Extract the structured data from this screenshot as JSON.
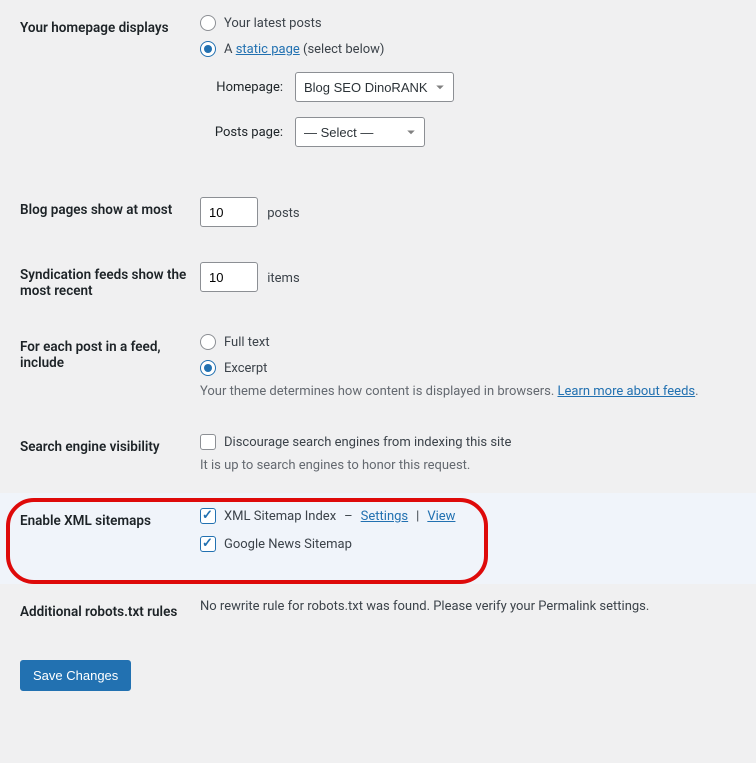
{
  "homepage": {
    "label": "Your homepage displays",
    "latest_posts": "Your latest posts",
    "static_page_prefix": "A ",
    "static_page_link": "static page",
    "static_page_suffix": " (select below)",
    "homepage_label": "Homepage:",
    "homepage_select": "Blog SEO DinoRANK",
    "posts_page_label": "Posts page:",
    "posts_page_select": "— Select —"
  },
  "blog_pages": {
    "label": "Blog pages show at most",
    "value": "10",
    "unit": "posts"
  },
  "syndication": {
    "label": "Syndication feeds show the most recent",
    "value": "10",
    "unit": "items"
  },
  "feed_content": {
    "label": "For each post in a feed, include",
    "full": "Full text",
    "excerpt": "Excerpt",
    "desc_prefix": "Your theme determines how content is displayed in browsers. ",
    "desc_link": "Learn more about feeds",
    "desc_suffix": "."
  },
  "search_visibility": {
    "label": "Search engine visibility",
    "checkbox": "Discourage search engines from indexing this site",
    "desc": "It is up to search engines to honor this request."
  },
  "xml_sitemaps": {
    "label": "Enable XML sitemaps",
    "index_label": "XML Sitemap Index",
    "dash": "–",
    "settings_link": "Settings",
    "divider": "|",
    "view_link": "View",
    "gnews_label": "Google News Sitemap"
  },
  "robots": {
    "label": "Additional robots.txt rules",
    "desc": "No rewrite rule for robots.txt was found. Please verify your Permalink settings."
  },
  "save": {
    "label": "Save Changes"
  }
}
